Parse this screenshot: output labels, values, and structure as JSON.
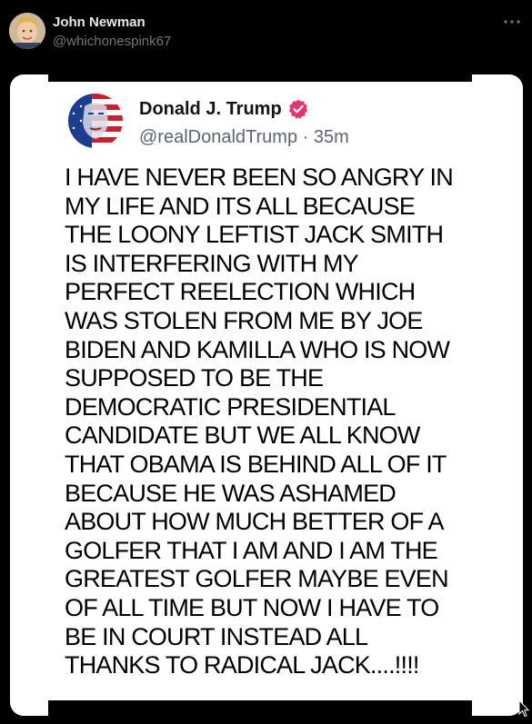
{
  "post": {
    "author_name": "John Newman",
    "author_handle": "@whichonespink67",
    "more_icon": "more-horizontal-icon"
  },
  "embedded_tweet": {
    "name": "Donald J. Trump",
    "handle": "@realDonaldTrump",
    "separator": "·",
    "time": "35m",
    "verified_icon": "verified-badge-icon",
    "verified_color": "#e2366f",
    "lines": [
      "I HAVE NEVER BEEN SO ANGRY IN",
      "MY LIFE AND ITS ALL BECAUSE",
      "THE LOONY LEFTIST JACK SMITH",
      "IS INTERFERING WITH MY",
      "PERFECT REELECTION WHICH",
      "WAS STOLEN FROM ME BY JOE",
      "BIDEN AND KAMILLA WHO IS NOW",
      "SUPPOSED TO BE THE",
      "DEMOCRATIC PRESIDENTIAL",
      "CANDIDATE BUT WE ALL KNOW",
      "THAT OBAMA IS BEHIND ALL OF IT",
      "BECAUSE HE WAS ASHAMED",
      "ABOUT HOW MUCH BETTER OF A",
      "GOLFER THAT I AM AND I AM THE",
      "GREATEST GOLFER MAYBE EVEN",
      "OF ALL TIME BUT NOW I HAVE TO",
      "BE IN COURT INSTEAD ALL",
      "THANKS TO RADICAL JACK....!!!!"
    ]
  },
  "colors": {
    "background": "#000000",
    "name_text": "#e7e9ea",
    "secondary_text": "#71767b",
    "card_background": "#ffffff"
  }
}
